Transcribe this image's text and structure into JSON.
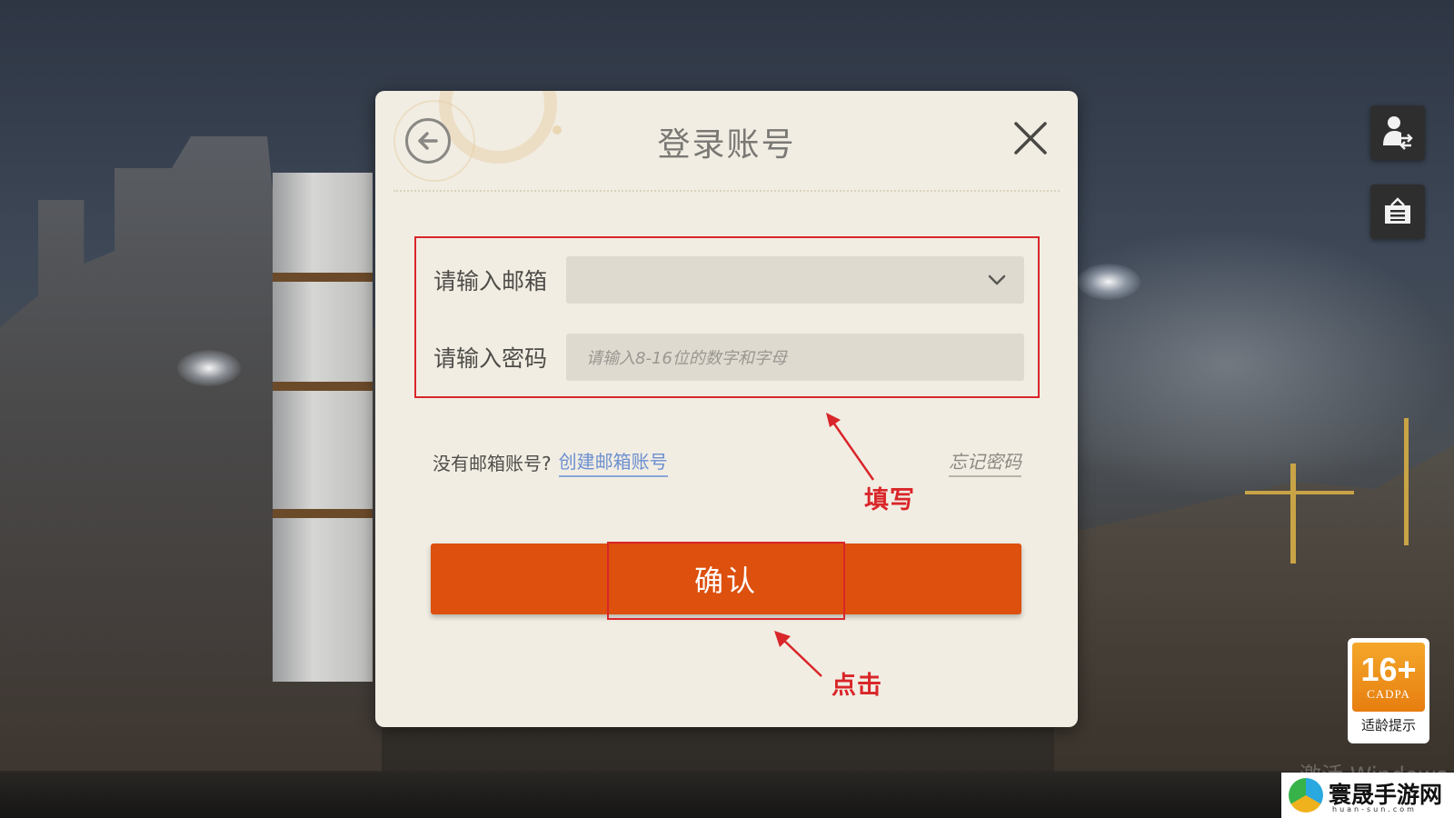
{
  "dialog": {
    "title": "登录账号",
    "email_label": "请输入邮箱",
    "email_value": "",
    "password_label": "请输入密码",
    "password_placeholder": "请输入8-16位的数字和字母",
    "no_account_text": "没有邮箱账号?",
    "create_link": "创建邮箱账号",
    "forgot_link": "忘记密码",
    "confirm_label": "确认"
  },
  "annotations": {
    "fill_label": "填写",
    "click_label": "点击",
    "color": "#d9262a"
  },
  "side_buttons": [
    {
      "icon": "switch-account-icon"
    },
    {
      "icon": "announcement-board-icon"
    }
  ],
  "age_rating": {
    "age": "16+",
    "org": "CADPA",
    "tip": "适龄提示"
  },
  "watermark": {
    "windows_text": "激活 Windows",
    "site_name": "寰晟手游网",
    "site_url": "huan-sun.com"
  },
  "colors": {
    "accent": "#dd500d",
    "dialog_bg": "#f1ede3",
    "link": "#6c8fd0"
  }
}
